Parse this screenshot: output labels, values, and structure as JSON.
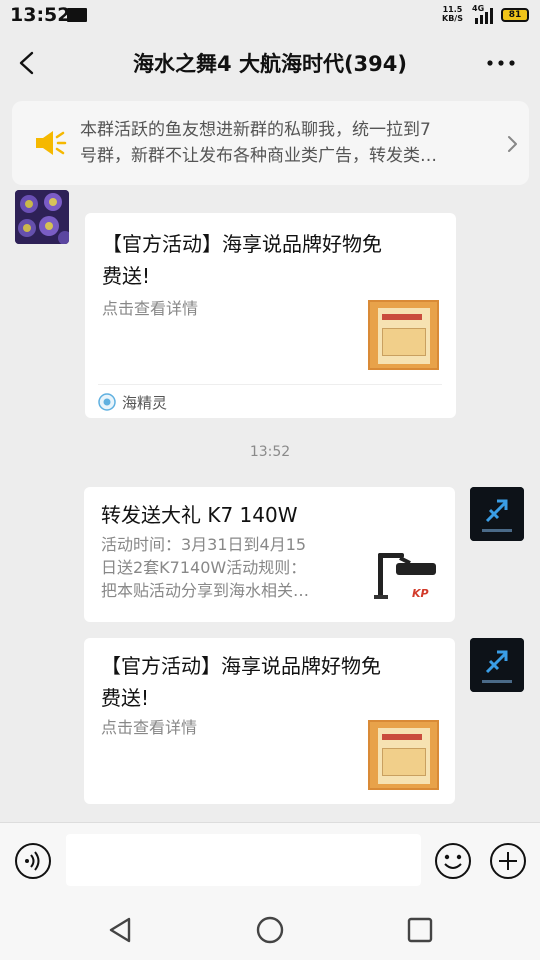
{
  "status_bar": {
    "time": "13:52",
    "net_rate_value": "11.5",
    "net_rate_unit": "KB/S",
    "network": "4G",
    "battery": "81"
  },
  "header": {
    "title": "海水之舞4 大航海时代(394)"
  },
  "notice": {
    "line1": "本群活跃的鱼友想进新群的私聊我，统一拉到7",
    "line2": "号群，新群不让发布各种商业类广告，转发类…"
  },
  "messages": [
    {
      "side": "left",
      "title_line1": "【官方活动】海享说品牌好物免",
      "title_line2": "费送!",
      "desc": "点击查看详情",
      "source": "海精灵"
    },
    {
      "side": "right",
      "title": "转发送大礼 K7 140W",
      "desc_line1": "活动时间：3月31日到4月15",
      "desc_line2": "日送2套K7140W活动规则：",
      "desc_line3": "把本贴活动分享到海水相关…"
    },
    {
      "side": "right",
      "title_line1": "【官方活动】海享说品牌好物免",
      "title_line2": "费送!",
      "desc": "点击查看详情"
    }
  ],
  "timestamp": "13:52",
  "input": {
    "value": "",
    "placeholder": ""
  },
  "icons": {
    "back": "back-arrow-icon",
    "more": "more-dots-icon",
    "speaker": "speaker-icon",
    "voice": "voice-icon",
    "emoji": "emoji-icon",
    "plus": "plus-icon"
  },
  "colors": {
    "background": "#ededed",
    "card": "#ffffff",
    "speaker": "#f5b800",
    "text_secondary": "#888888"
  }
}
